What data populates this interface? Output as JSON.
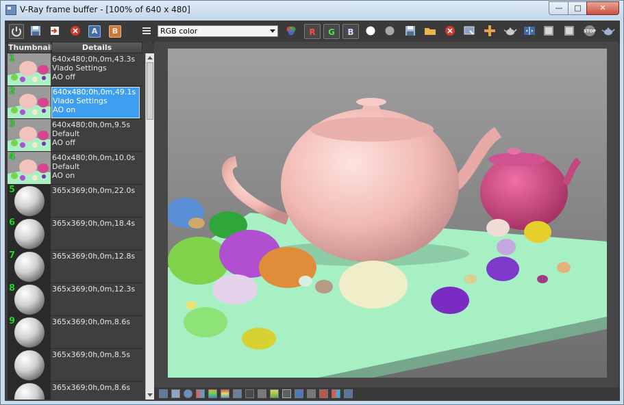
{
  "window": {
    "title": "V-Ray frame buffer - [100% of 640 x 480]",
    "min_glyph": "—",
    "max_glyph": "□",
    "close_glyph": "✕"
  },
  "toolbar": {
    "channel_select": "RGB color",
    "r_label": "R",
    "g_label": "G",
    "b_label": "B",
    "layer_a_label": "A",
    "layer_b_label": "B"
  },
  "history": {
    "columns": [
      "Thumbnail",
      "Details"
    ],
    "items": [
      {
        "num": "1",
        "details": "640x480;0h,0m,43.3s",
        "line2": "Vlado Settings",
        "line3": "AO off",
        "thumb": "teapot"
      },
      {
        "num": "2",
        "details": "640x480;0h,0m,49.1s",
        "line2": "Vlado Settings",
        "line3": "AO on",
        "thumb": "teapot",
        "selected": true
      },
      {
        "num": "3",
        "details": "640x480;0h,0m,9.5s",
        "line2": "Default",
        "line3": "AO off",
        "thumb": "teapot"
      },
      {
        "num": "4",
        "details": "640x480;0h,0m,10.0s",
        "line2": "Default",
        "line3": "AO on",
        "thumb": "teapot"
      },
      {
        "num": "5",
        "details": "365x369;0h,0m,22.0s",
        "line2": "",
        "line3": "",
        "thumb": "sphere"
      },
      {
        "num": "6",
        "details": "365x369;0h,0m,18.4s",
        "line2": "",
        "line3": "",
        "thumb": "sphere"
      },
      {
        "num": "7",
        "details": "365x369;0h,0m,12.8s",
        "line2": "",
        "line3": "",
        "thumb": "sphere"
      },
      {
        "num": "8",
        "details": "365x369;0h,0m,12.3s",
        "line2": "",
        "line3": "",
        "thumb": "sphere"
      },
      {
        "num": "9",
        "details": "365x369;0h,0m,8.6s",
        "line2": "",
        "line3": "",
        "thumb": "sphere"
      },
      {
        "num": "",
        "details": "365x369;0h,0m,8.5s",
        "line2": "",
        "line3": "",
        "thumb": "sphere"
      },
      {
        "num": "",
        "details": "365x369;0h,0m,8.6s",
        "line2": "",
        "line3": "",
        "thumb": "sphere"
      }
    ]
  },
  "icons": {
    "toolbar": [
      "power-icon",
      "save-icon",
      "load-icon",
      "clear-icon",
      "layer-a-icon",
      "layer-b-icon",
      "menu-icon",
      "color-wheel-icon",
      "red-channel-icon",
      "green-channel-icon",
      "blue-channel-icon",
      "white-circle-icon",
      "gray-circle-icon",
      "save-image-icon",
      "open-folder-icon",
      "stop-red-icon",
      "region-icon",
      "track-mouse-icon",
      "render-teapot-icon",
      "ab-compare-icon",
      "layer-a-toggle-icon",
      "layer-b-toggle-icon",
      "stop-icon",
      "teapot-icon"
    ],
    "bottom": [
      "display-icon",
      "history-icon",
      "info-icon",
      "color-corrections-icon",
      "hsl-icon",
      "levels-icon",
      "histogram-icon",
      "curve-icon",
      "lut-icon",
      "background-icon",
      "sRGB-icon",
      "ocio-icon",
      "h-icon",
      "lens-icon",
      "ab-icon",
      "star-icon"
    ]
  },
  "colors": {
    "selection": "#3e9ef0",
    "history_number": "#1fdc1f"
  }
}
